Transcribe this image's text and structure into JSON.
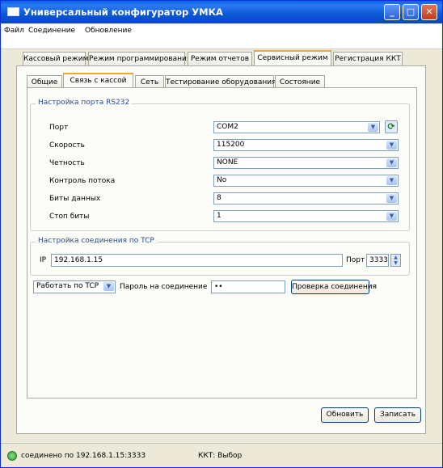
{
  "window": {
    "title": "Универсальный конфигуратор УМКА"
  },
  "menu": [
    "Файл",
    "Соединение",
    "Обновление"
  ],
  "main_tabs": [
    "Кассовый режим",
    "Режим программирования",
    "Режим отчетов",
    "Сервисный режим",
    "Регистрация ККТ"
  ],
  "sub_tabs": [
    "Общие",
    "Связь с кассой",
    "Сеть",
    "Тестирование оборудования",
    "Состояние"
  ],
  "rs232": {
    "title": "Настройка порта RS232",
    "port": {
      "label": "Порт",
      "value": "COM2"
    },
    "speed": {
      "label": "Скорость",
      "value": "115200"
    },
    "parity": {
      "label": "Четность",
      "value": "NONE"
    },
    "flow": {
      "label": "Контроль потока",
      "value": "No"
    },
    "databits": {
      "label": "Биты данных",
      "value": "8"
    },
    "stopbits": {
      "label": "Стоп биты",
      "value": "1"
    }
  },
  "tcp": {
    "title": "Настройка соединения по TCP",
    "ip_label": "IP",
    "ip_value": "192.168.1.15",
    "port_label": "Порт",
    "port_value": "3333"
  },
  "mode": {
    "value": "Работать по TCP",
    "password_label": "Пароль на соединение",
    "password_value": "••",
    "check_button": "Проверка соединения"
  },
  "buttons": {
    "refresh": "Обновить",
    "write": "Записать"
  },
  "status": {
    "connection": "соединено по 192.168.1.15:3333",
    "kkt": "ККТ: Выбор"
  }
}
